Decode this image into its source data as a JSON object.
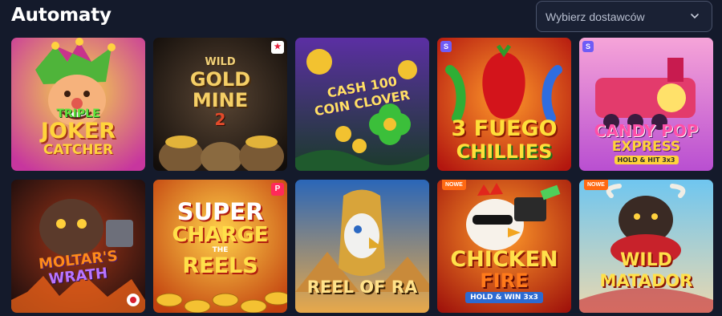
{
  "page": {
    "title": "Automaty"
  },
  "filter": {
    "provider_placeholder": "Wybierz dostawców",
    "chevron_icon": "chevron-down-icon"
  },
  "games": [
    {
      "title_lines": [
        "TRIPLE",
        "JOKER",
        "CATCHER"
      ]
    },
    {
      "title_lines": [
        "WILD",
        "GOLD",
        "MINE",
        "2"
      ],
      "corner_icon": "star-icon"
    },
    {
      "title_lines": [
        "CASH 100",
        "COIN CLOVER"
      ]
    },
    {
      "title_lines": [
        "3 FUEGO",
        "CHILLIES"
      ],
      "provider_mark": "S"
    },
    {
      "title_lines": [
        "CANDY POP",
        "EXPRESS",
        "HOLD & HIT 3x3"
      ],
      "provider_mark": "S"
    },
    {
      "title_lines": [
        "MOLTAR'S",
        "WRATH"
      ]
    },
    {
      "title_lines": [
        "SUPER",
        "CHARGE",
        "THE",
        "REELS"
      ],
      "provider_mark": "P"
    },
    {
      "title_lines": [
        "REEL OF RA"
      ]
    },
    {
      "title_lines": [
        "CHICKEN",
        "FIRE",
        "HOLD & WIN 3x3"
      ],
      "badge": "NOWE"
    },
    {
      "title_lines": [
        "WILD",
        "MATADOR"
      ],
      "badge": "NOWE"
    }
  ]
}
